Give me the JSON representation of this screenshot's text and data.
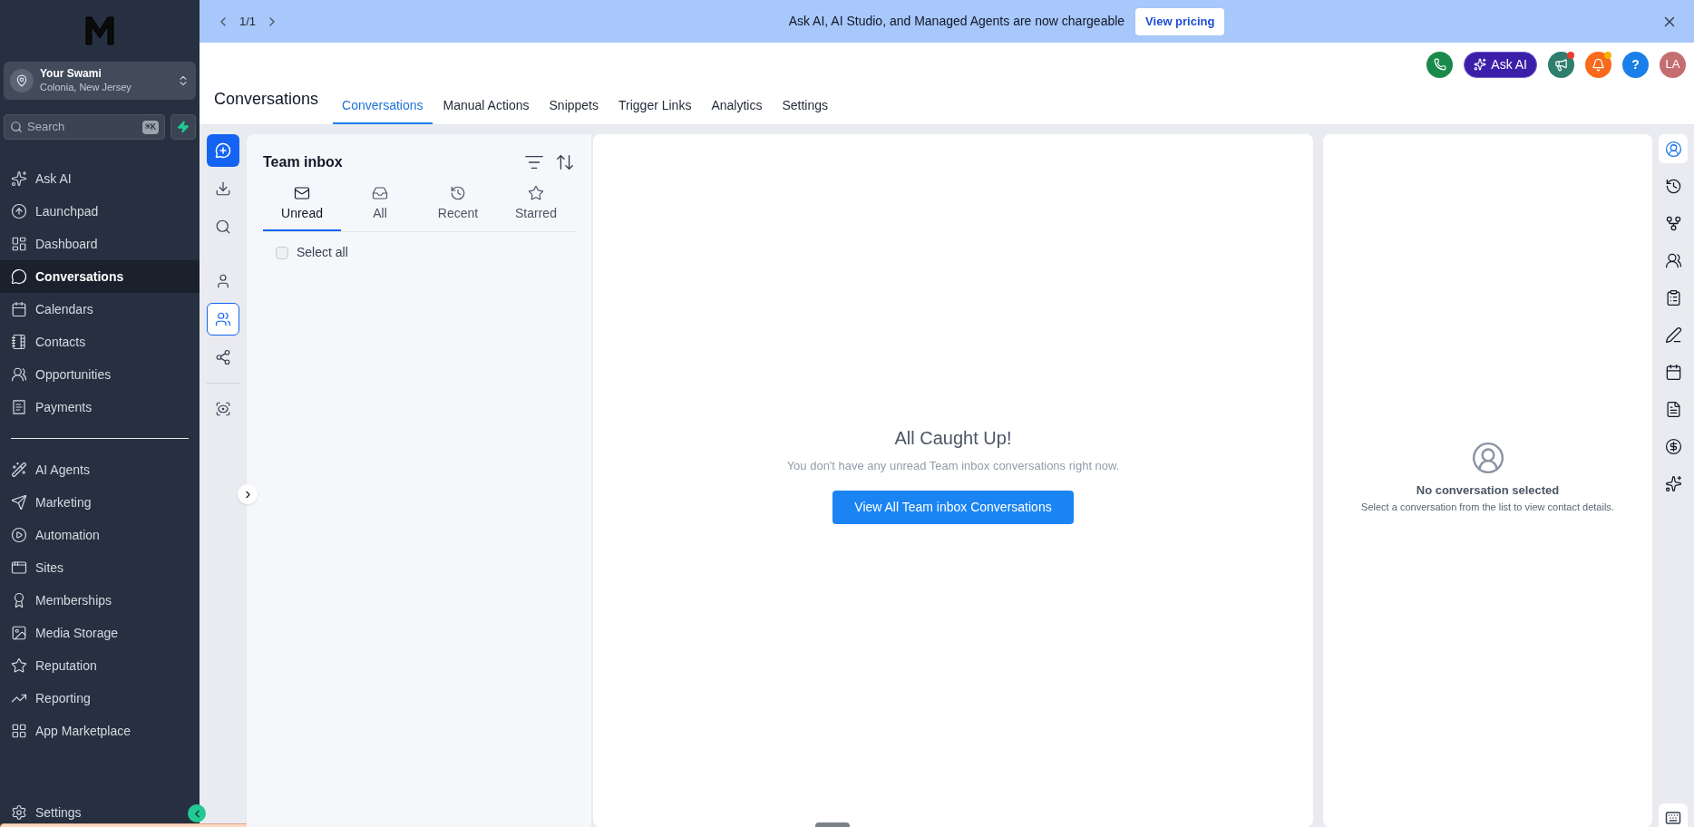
{
  "banner": {
    "pager": "1/1",
    "message": "Ask AI, AI Studio, and Managed Agents are now chargeable",
    "button": "View pricing"
  },
  "sidebar": {
    "account": {
      "name": "Your Swami",
      "location": "Colonia, New Jersey"
    },
    "search": {
      "placeholder": "Search",
      "shortcut": "⌘K"
    },
    "nav_items": [
      {
        "label": "Ask AI",
        "selected": false
      },
      {
        "label": "Launchpad",
        "selected": false
      },
      {
        "label": "Dashboard",
        "selected": false
      },
      {
        "label": "Conversations",
        "selected": true
      },
      {
        "label": "Calendars",
        "selected": false
      },
      {
        "label": "Contacts",
        "selected": false
      },
      {
        "label": "Opportunities",
        "selected": false
      },
      {
        "label": "Payments",
        "selected": false
      }
    ],
    "more_items": [
      {
        "label": "AI Agents",
        "selected": false
      },
      {
        "label": "Marketing",
        "selected": false
      },
      {
        "label": "Automation",
        "selected": false
      },
      {
        "label": "Sites",
        "selected": false
      },
      {
        "label": "Memberships",
        "selected": false
      },
      {
        "label": "Media Storage",
        "selected": false
      },
      {
        "label": "Reputation",
        "selected": false
      },
      {
        "label": "Reporting",
        "selected": false
      },
      {
        "label": "App Marketplace",
        "selected": false
      }
    ],
    "settings": "Settings"
  },
  "header": {
    "title": "Conversations",
    "tabs": [
      {
        "label": "Conversations",
        "selected": true
      },
      {
        "label": "Manual Actions",
        "selected": false
      },
      {
        "label": "Snippets",
        "selected": false
      },
      {
        "label": "Trigger Links",
        "selected": false
      },
      {
        "label": "Analytics",
        "selected": false
      },
      {
        "label": "Settings",
        "selected": false
      }
    ],
    "ask_ai": "Ask AI",
    "help": "?",
    "avatar": "LA",
    "alerts": [
      {
        "kind": "announcements",
        "unread": true
      },
      {
        "kind": "notifications",
        "unread": true
      }
    ]
  },
  "inbox_rail": [
    {
      "selected": false
    },
    {
      "selected": false
    },
    {
      "selected": false
    },
    {
      "selected": true
    },
    {
      "selected": false
    },
    {
      "selected": false
    }
  ],
  "inbox": {
    "title": "Team inbox",
    "filters": [
      {
        "label": "Unread",
        "selected": true
      },
      {
        "label": "All",
        "selected": false
      },
      {
        "label": "Recent",
        "selected": false
      },
      {
        "label": "Starred",
        "selected": false
      }
    ],
    "select_all": {
      "label": "Select all",
      "checked": false
    }
  },
  "empty_state": {
    "heading": "All Caught Up!",
    "message": "You don't have any unread Team inbox conversations right now.",
    "button": "View All Team inbox Conversations"
  },
  "contact_panel": {
    "title": "No conversation selected",
    "message": "Select a conversation from the list to view contact details."
  },
  "right_rail": [
    {
      "selected": true
    },
    {
      "selected": false
    },
    {
      "selected": false
    },
    {
      "selected": false
    },
    {
      "selected": false
    },
    {
      "selected": false
    },
    {
      "selected": false
    },
    {
      "selected": false
    },
    {
      "selected": false
    },
    {
      "selected": false
    }
  ]
}
